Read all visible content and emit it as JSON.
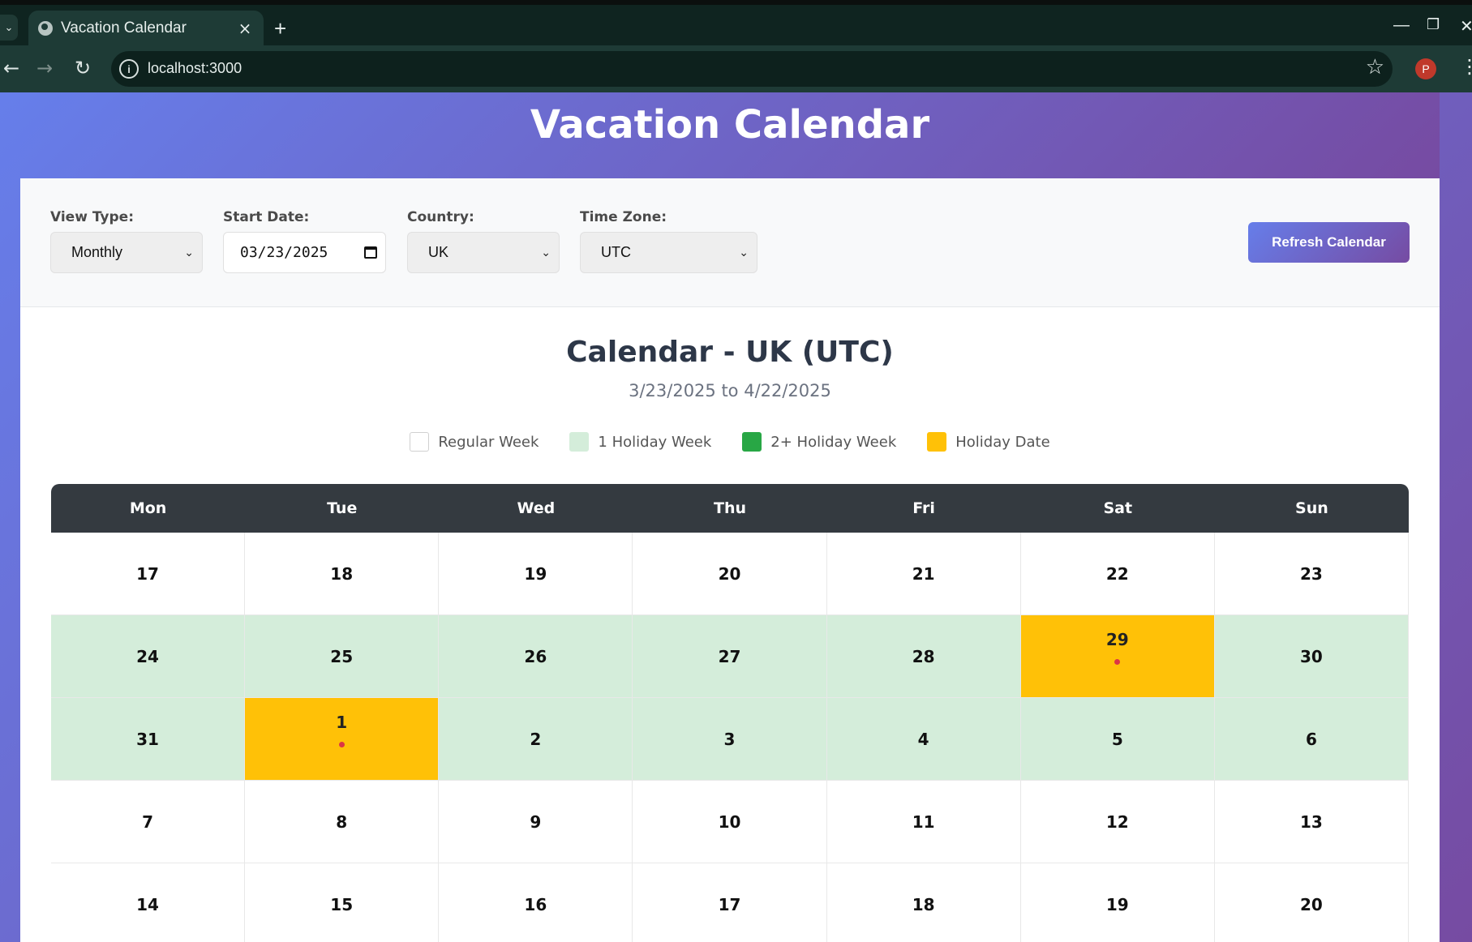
{
  "browser": {
    "tab_title": "Vacation Calendar",
    "url": "localhost:3000",
    "profile_initial": "P"
  },
  "header": {
    "title": "Vacation Calendar"
  },
  "controls": {
    "view_type": {
      "label": "View Type:",
      "value": "Monthly"
    },
    "start_date": {
      "label": "Start Date:",
      "value": "03/23/2025"
    },
    "country": {
      "label": "Country:",
      "value": "UK"
    },
    "time_zone": {
      "label": "Time Zone:",
      "value": "UTC"
    },
    "refresh_label": "Refresh Calendar"
  },
  "calendar": {
    "title": "Calendar - UK (UTC)",
    "range": "3/23/2025 to 4/22/2025",
    "legend": [
      {
        "label": "Regular Week",
        "color": "#ffffff"
      },
      {
        "label": "1 Holiday Week",
        "color": "#d4edda"
      },
      {
        "label": "2+ Holiday Week",
        "color": "#28a745"
      },
      {
        "label": "Holiday Date",
        "color": "#ffc107"
      }
    ],
    "weekdays": [
      "Mon",
      "Tue",
      "Wed",
      "Thu",
      "Fri",
      "Sat",
      "Sun"
    ],
    "weeks": [
      {
        "type": "regular",
        "days": [
          "17",
          "18",
          "19",
          "20",
          "21",
          "22",
          "23"
        ],
        "holidays": []
      },
      {
        "type": "one",
        "days": [
          "24",
          "25",
          "26",
          "27",
          "28",
          "29",
          "30"
        ],
        "holidays": [
          5
        ]
      },
      {
        "type": "one",
        "days": [
          "31",
          "1",
          "2",
          "3",
          "4",
          "5",
          "6"
        ],
        "holidays": [
          1
        ]
      },
      {
        "type": "regular",
        "days": [
          "7",
          "8",
          "9",
          "10",
          "11",
          "12",
          "13"
        ],
        "holidays": []
      },
      {
        "type": "regular",
        "days": [
          "14",
          "15",
          "16",
          "17",
          "18",
          "19",
          "20"
        ],
        "holidays": []
      }
    ]
  }
}
